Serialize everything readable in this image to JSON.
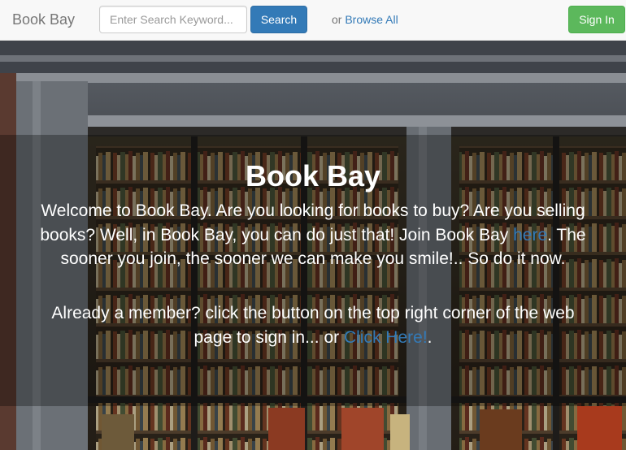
{
  "navbar": {
    "brand": "Book Bay",
    "search_placeholder": "Enter Search Keyword...",
    "search_button": "Search",
    "browse_prefix": "or",
    "browse_link": "Browse All",
    "signin_button": "Sign In"
  },
  "hero": {
    "title": "Book Bay",
    "p1_before": "Welcome to Book Bay. Are you looking for books to buy? Are you selling books? Well, in Book Bay, you can do just that! Join Book Bay",
    "p1_link": "here",
    "p1_after": ". The sooner you join, the sooner we can make you smile!.. So do it now.",
    "p2_before": "Already a member? click the button on the top right corner of the web page to sign in... or",
    "p2_link": "Click Here!",
    "p2_after": "."
  },
  "colors": {
    "link": "#337ab7",
    "primary_button": "#337ab7",
    "success_button": "#5cb85c",
    "navbar_bg": "#f8f8f8"
  }
}
